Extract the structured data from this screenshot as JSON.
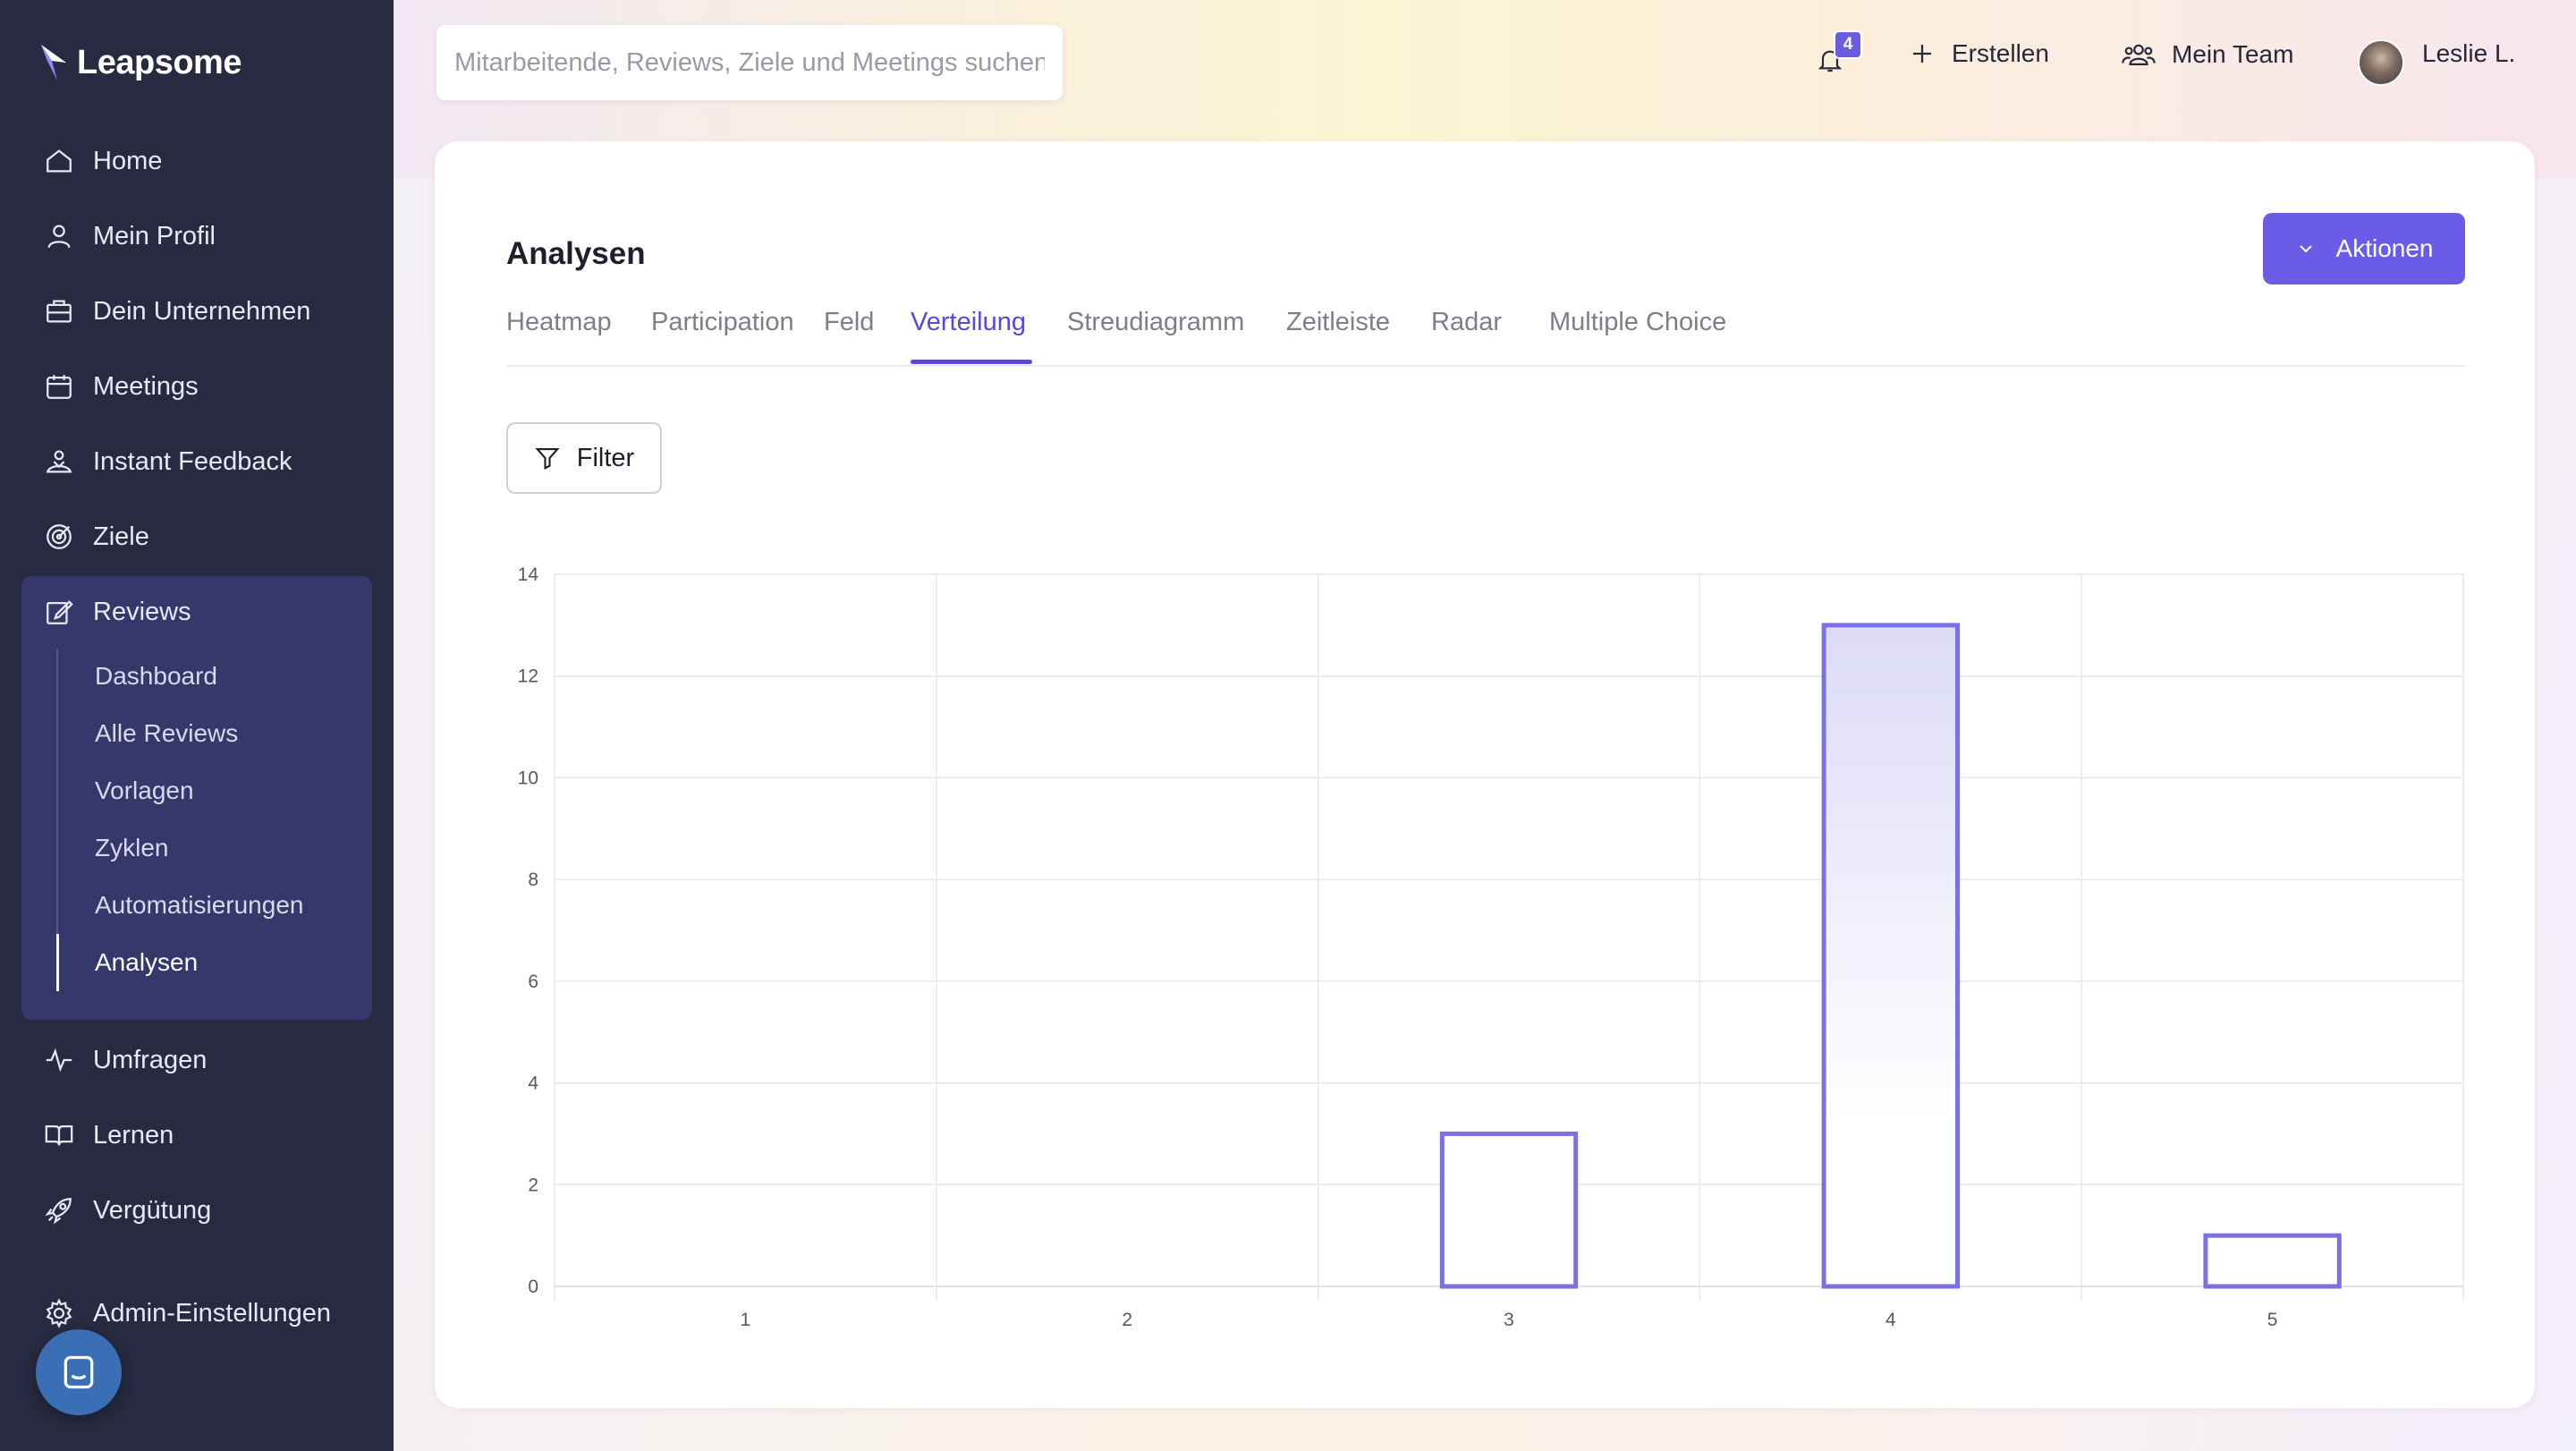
{
  "brand": {
    "name": "Leapsome"
  },
  "sidebar": {
    "items": [
      {
        "label": "Home",
        "icon": "home-icon"
      },
      {
        "label": "Mein Profil",
        "icon": "user-icon"
      },
      {
        "label": "Dein Unternehmen",
        "icon": "briefcase-icon"
      },
      {
        "label": "Meetings",
        "icon": "calendar-icon"
      },
      {
        "label": "Instant Feedback",
        "icon": "feedback-icon"
      },
      {
        "label": "Ziele",
        "icon": "target-icon"
      },
      {
        "label": "Reviews",
        "icon": "edit-icon"
      },
      {
        "label": "Umfragen",
        "icon": "pulse-icon"
      },
      {
        "label": "Lernen",
        "icon": "book-icon"
      },
      {
        "label": "Vergütung",
        "icon": "rocket-icon"
      },
      {
        "label": "Admin-Einstellungen",
        "icon": "gear-icon"
      }
    ],
    "reviews_sub": [
      "Dashboard",
      "Alle Reviews",
      "Vorlagen",
      "Zyklen",
      "Automatisierungen",
      "Analysen"
    ],
    "active_sub": "Analysen"
  },
  "header": {
    "search_placeholder": "Mitarbeitende, Reviews, Ziele und Meetings suchen",
    "notification_count": "4",
    "create_label": "Erstellen",
    "team_label": "Mein Team",
    "user_name": "Leslie L."
  },
  "main": {
    "title": "Analysen",
    "actions_label": "Aktionen",
    "tabs": [
      "Heatmap",
      "Participation",
      "Feld",
      "Verteilung",
      "Streudiagramm",
      "Zeitleiste",
      "Radar",
      "Multiple Choice"
    ],
    "active_tab": "Verteilung",
    "filter_label": "Filter"
  },
  "colors": {
    "accent": "#6b5ce7",
    "sidebar_bg": "#272a40",
    "bar_stroke": "#7b70e4"
  },
  "chart_data": {
    "type": "bar",
    "categories": [
      "1",
      "2",
      "3",
      "4",
      "5"
    ],
    "values": [
      0,
      0,
      3,
      13,
      1
    ],
    "ylim": [
      0,
      14
    ],
    "yticks": [
      0,
      2,
      4,
      6,
      8,
      10,
      12,
      14
    ],
    "grid": true,
    "title": "",
    "xlabel": "",
    "ylabel": ""
  }
}
